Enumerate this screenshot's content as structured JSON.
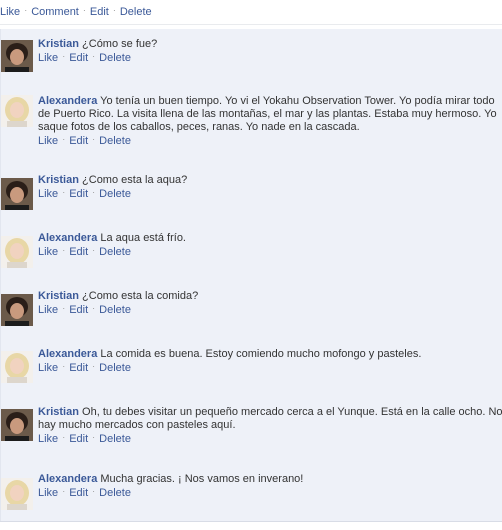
{
  "top_actions": {
    "like": "Like",
    "comment": "Comment",
    "edit": "Edit",
    "delete": "Delete",
    "separator": "·"
  },
  "comments": [
    {
      "author": "Kristian",
      "avatar": "kristian-avatar",
      "text": "¿Cómo se fue?",
      "like": "Like",
      "edit": "Edit",
      "delete": "Delete"
    },
    {
      "author": "Alexandera",
      "avatar": "alexandera-avatar",
      "text": "Yo tenía un buen tiempo. Yo vi el Yokahu Observation Tower. Yo podía mirar todo de Puerto Rico. La visita llena de las montañas, el mar y las plantas. Estaba muy hermoso. Yo saque fotos de los caballos, peces, ranas. Yo nade en la cascada.",
      "like": "Like",
      "edit": "Edit",
      "delete": "Delete"
    },
    {
      "author": "Kristian",
      "avatar": "kristian-avatar",
      "text": "¿Como esta la aqua?",
      "like": "Like",
      "edit": "Edit",
      "delete": "Delete"
    },
    {
      "author": "Alexandera",
      "avatar": "alexandera-avatar",
      "text": "La aqua está frío.",
      "like": "Like",
      "edit": "Edit",
      "delete": "Delete"
    },
    {
      "author": "Kristian",
      "avatar": "kristian-avatar",
      "text": "¿Como esta la comida?",
      "like": "Like",
      "edit": "Edit",
      "delete": "Delete"
    },
    {
      "author": "Alexandera",
      "avatar": "alexandera-avatar",
      "text": "La comida es buena. Estoy comiendo mucho mofongo y pasteles.",
      "like": "Like",
      "edit": "Edit",
      "delete": "Delete"
    },
    {
      "author": "Kristian",
      "avatar": "kristian-avatar",
      "text": "Oh, tu debes visitar un pequeño mercado cerca a el Yunque. Está en la calle ocho. No hay mucho mercados con pasteles aquí.",
      "like": "Like",
      "edit": "Edit",
      "delete": "Delete"
    },
    {
      "author": "Alexandera",
      "avatar": "alexandera-avatar",
      "text": "Mucha gracias. ¡ Nos vamos en inverano!",
      "like": "Like",
      "edit": "Edit",
      "delete": "Delete"
    }
  ]
}
